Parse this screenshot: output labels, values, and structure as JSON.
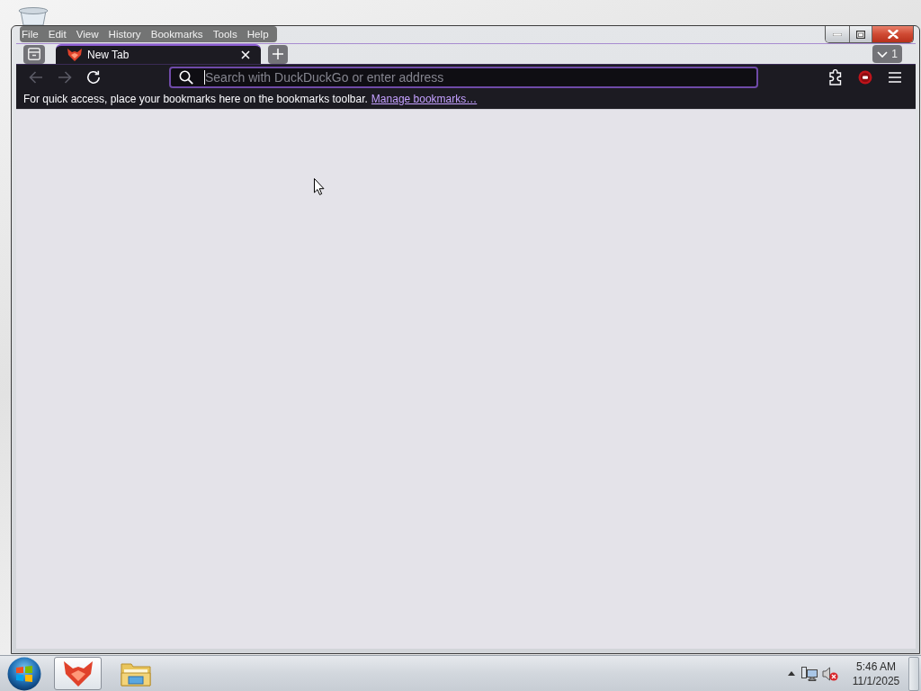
{
  "window": {
    "menu": [
      {
        "label": "File"
      },
      {
        "label": "Edit"
      },
      {
        "label": "View"
      },
      {
        "label": "History"
      },
      {
        "label": "Bookmarks"
      },
      {
        "label": "Tools"
      },
      {
        "label": "Help"
      }
    ],
    "tabs": [
      {
        "title": "New Tab",
        "selected": true
      }
    ],
    "tab_list": {
      "count": "1"
    },
    "nav_buttons": [
      {
        "kind": "back",
        "disabled": true
      },
      {
        "kind": "forward",
        "disabled": true
      },
      {
        "kind": "reload",
        "disabled": false
      }
    ],
    "address_bar": {
      "placeholder": "Search with DuckDuckGo or enter address",
      "focused": true
    },
    "toolbar_buttons": [
      {
        "kind": "extensions"
      },
      {
        "kind": "addon"
      },
      {
        "kind": "menu"
      }
    ],
    "bookmarks_toolbar": {
      "message": "For quick access, place your bookmarks here on the bookmarks toolbar.",
      "link": "Manage bookmarks…"
    }
  },
  "taskbar": {
    "apps": [
      {
        "kind": "browser",
        "selected": true
      },
      {
        "kind": "file_explorer",
        "selected": false
      }
    ],
    "tray": {
      "volume_muted": true
    },
    "clock": {
      "time": "5:46 AM",
      "date": "11/1/2025"
    }
  }
}
